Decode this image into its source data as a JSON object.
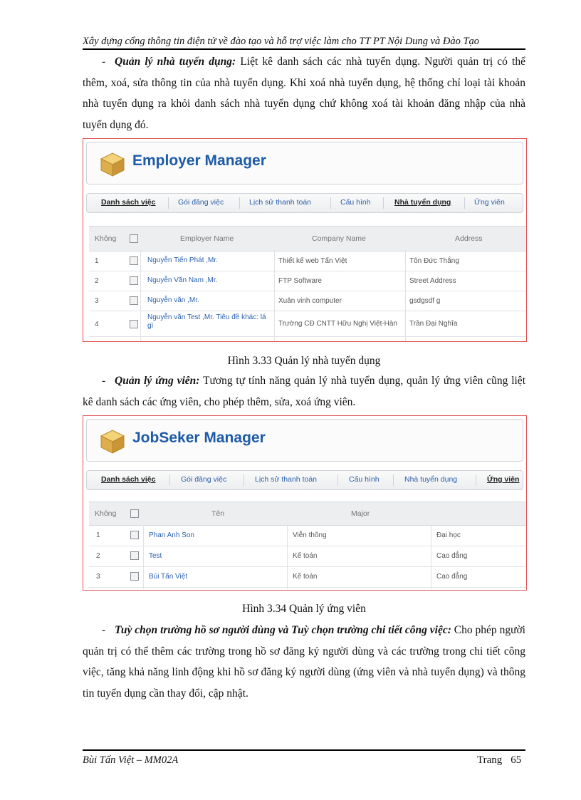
{
  "header": "Xây dựng cổng thông tin điện tử về đào tạo và hỗ trợ việc làm cho TT PT Nội Dung và Đào Tạo",
  "para1": {
    "dash": "-",
    "bold": "Quản lý nhà tuyển dụng:",
    "text": " Liệt kê danh sách các nhà tuyển dụng. Người quản trị có thể thêm, xoá, sửa thông tin của nhà tuyển dụng. Khi xoá nhà tuyển dụng, hệ thống chỉ loại tài khoản nhà tuyển dụng ra khỏi danh sách nhà tuyển dụng chứ không xoá tài khoản đăng nhập của nhà tuyển dụng đó."
  },
  "fig1": {
    "title": "Employer Manager",
    "caption": "Hình 3.33 Quản lý nhà tuyển dụng",
    "nav": [
      "Danh sách việc",
      "Gói đăng việc",
      "Lịch sử thanh toán",
      "Cấu hình",
      "Nhà tuyển dụng",
      "Ứng viên"
    ],
    "columns": [
      "Không",
      "Employer Name",
      "Company Name",
      "Address"
    ],
    "rows": [
      {
        "no": "1",
        "name": "Nguyễn Tiến Phát ,Mr.",
        "company": "Thiết kế web Tấn Việt",
        "address": "Tôn Đức Thắng"
      },
      {
        "no": "2",
        "name": "Nguyễn Văn Nam ,Mr.",
        "company": "FTP Software",
        "address": "Street Address"
      },
      {
        "no": "3",
        "name": "Nguyễn văn ,Mr.",
        "company": "Xuân vinh computer",
        "address": "gsdgsdf g"
      },
      {
        "no": "4",
        "name": "Nguyễn văn Test ,Mr. Tiêu đề khác: lá gì",
        "company": "Trường CĐ CNTT Hữu Nghị Việt-Hàn",
        "address": "Trần Đại Nghĩa"
      }
    ]
  },
  "para2": {
    "dash": "-",
    "bold": "Quản lý ứng viên:",
    "text": " Tương tự tính năng quản lý nhà tuyển dụng, quản lý ứng viên cũng liệt kê danh sách các ứng viên, cho phép thêm, sửa, xoá ứng viên."
  },
  "fig2": {
    "title": "JobSeker Manager",
    "caption": "Hình 3.34 Quản lý ứng viên",
    "nav": [
      "Danh sách việc",
      "Gói đăng việc",
      "Lịch sử thanh toán",
      "Cấu hình",
      "Nhà tuyển dụng",
      "Ứng viên"
    ],
    "columns": [
      "Không",
      "Tên",
      "Major"
    ],
    "rows": [
      {
        "no": "1",
        "name": "Phan Anh Son",
        "major": "Viễn thông",
        "degree": "Đại học"
      },
      {
        "no": "2",
        "name": "Test",
        "major": "Kế toán",
        "degree": "Cao đẳng"
      },
      {
        "no": "3",
        "name": "Bùi Tấn Việt",
        "major": "Kế toán",
        "degree": "Cao đẳng"
      }
    ]
  },
  "para3": {
    "dash": "-",
    "bold": "Tuỳ chọn trường hồ sơ người dùng và Tuỳ chọn trường chi tiết công việc:",
    "text": " Cho phép người quản trị có thể thêm các trường trong hồ sơ đăng ký người dùng và các trường trong chi tiết công việc, tăng khả năng linh động khi hồ sơ đăng ký người dùng (ứng viên và nhà tuyển dụng) và thông tin tuyển dụng cần thay đổi, cập nhật."
  },
  "footer": {
    "author": "Bùi Tấn Việt – MM02A",
    "page_label": "Trang",
    "page_number": "65"
  }
}
